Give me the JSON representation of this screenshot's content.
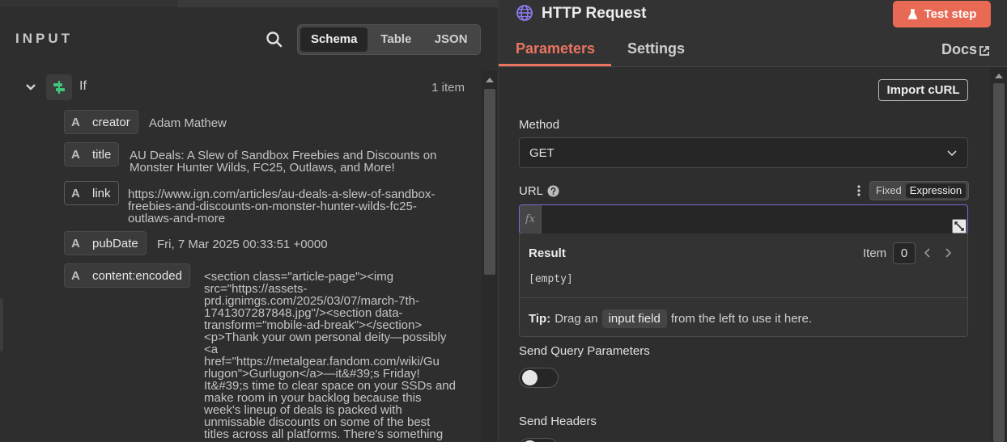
{
  "input_panel": {
    "title": "INPUT",
    "view_modes": [
      "Schema",
      "Table",
      "JSON"
    ],
    "active_view": "Schema",
    "node": {
      "name": "If",
      "item_count": "1 item"
    },
    "fields": [
      {
        "key": "creator",
        "type": "A",
        "value": "Adam Mathew"
      },
      {
        "key": "title",
        "type": "A",
        "value_lines": [
          "AU Deals: A Slew of Sandbox Freebies and Discounts on",
          "Monster Hunter Wilds, FC25, Outlaws, and More!"
        ]
      },
      {
        "key": "link",
        "type": "A",
        "value_lines": [
          "https://www.ign.com/articles/au-deals-a-slew-of-sandbox-",
          "freebies-and-discounts-on-monster-hunter-wilds-fc25-",
          "outlaws-and-more"
        ]
      },
      {
        "key": "pubDate",
        "type": "A",
        "value": "Fri, 7 Mar 2025 00:33:51 +0000"
      },
      {
        "key": "content:encoded",
        "type": "A",
        "value_lines": [
          "<section class=\"article-page\"><img",
          "src=\"https://assets-",
          "prd.ignimgs.com/2025/03/07/march-7th-",
          "1741307287848.jpg\"/><section data-",
          "transform=\"mobile-ad-break\"></section>",
          "<p>Thank your own personal deity—possibly",
          "<a",
          "href=\"https://metalgear.fandom.com/wiki/Gu",
          "rlugon\">Gurlugon</a>—it&#39;s Friday!",
          "It&#39;s time to clear space on your SSDs and",
          "make room in your backlog because this",
          "week's lineup of deals is packed with",
          "unmissable discounts on some of the best",
          "titles across all platforms. There's something"
        ]
      }
    ]
  },
  "node_panel": {
    "title": "HTTP Request",
    "test_button": "Test step",
    "tabs": [
      "Parameters",
      "Settings"
    ],
    "active_tab": "Parameters",
    "docs_label": "Docs",
    "import_button": "Import cURL",
    "method": {
      "label": "Method",
      "value": "GET"
    },
    "url": {
      "label": "URL",
      "modes": [
        "Fixed",
        "Expression"
      ],
      "active_mode": "Expression",
      "fx_label": "fx",
      "value": ""
    },
    "result": {
      "label": "Result",
      "item_label": "Item",
      "item_index": "0",
      "value": "[empty]"
    },
    "tip": {
      "strong": "Tip:",
      "before": "Drag an",
      "chip": "input field",
      "after": "from the left to use it here."
    },
    "send_query": {
      "label": "Send Query Parameters",
      "enabled": false
    },
    "send_headers": {
      "label": "Send Headers",
      "enabled": false
    }
  },
  "colors": {
    "accent": "#ea7460",
    "expression_border": "#7a6ad8",
    "if_icon": "#3fc57a",
    "globe_icon": "#8b7cf0"
  }
}
